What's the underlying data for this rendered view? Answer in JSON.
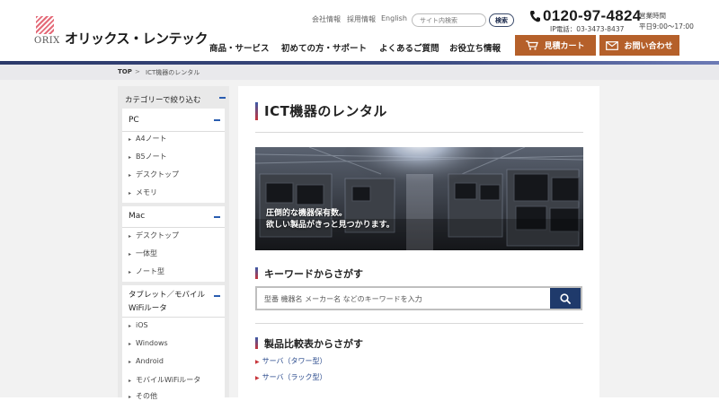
{
  "header": {
    "brand_name": "オリックス・レンテック",
    "brand_mark": "ORIX",
    "util_links": [
      "会社情報",
      "採用情報",
      "English"
    ],
    "search_placeholder": "サイト内検索",
    "search_button": "検索",
    "nav": [
      "商品・サービス",
      "初めての方・サポート",
      "よくあるご質問",
      "お役立ち情報"
    ],
    "phone": "0120-97-4824",
    "ip_phone": "IP電話：03-3473-8437",
    "hours_label": "営業時間",
    "hours": "平日9:00～17:00",
    "cart_button": "見積カート",
    "contact_button": "お問い合わせ"
  },
  "breadcrumb": {
    "top": "TOP",
    "separator": ">",
    "current": "ICT機器のレンタル"
  },
  "sidebar": {
    "heading": "カテゴリーで絞り込む",
    "groups": [
      {
        "name": "PC",
        "items": [
          "A4ノート",
          "B5ノート",
          "デスクトップ",
          "メモリ"
        ]
      },
      {
        "name": "Mac",
        "items": [
          "デスクトップ",
          "一体型",
          "ノート型"
        ]
      },
      {
        "name": "タブレット／モバイルWiFiルータ",
        "items": [
          "iOS",
          "Windows",
          "Android",
          "モバイルWiFiルータ",
          "その他"
        ]
      }
    ]
  },
  "content": {
    "title": "ICT機器のレンタル",
    "hero_line1": "圧倒的な機器保有数。",
    "hero_line2": "欲しい製品がきっと見つかります。",
    "keyword_title": "キーワードからさがす",
    "keyword_placeholder": "型番 機器名 メーカー名 などのキーワードを入力",
    "compare_title": "製品比較表からさがす",
    "compare_items": [
      "サーバ（タワー型）",
      "サーバ（ラック型）"
    ]
  },
  "colors": {
    "accent_orange": "#b5602a",
    "navy": "#1f3a6b",
    "link_blue": "#2a4a8c",
    "accent_red": "#c7343a"
  }
}
